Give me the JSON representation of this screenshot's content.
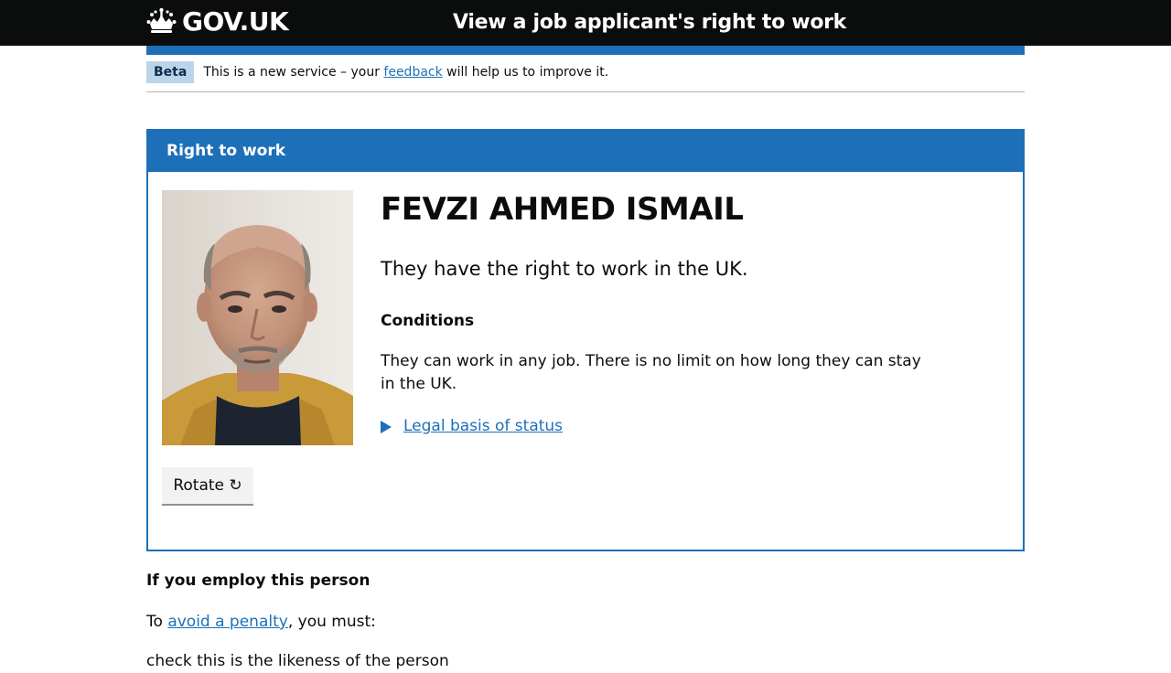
{
  "header": {
    "logo_text": "GOV.UK",
    "service_name": "View a job applicant's right to work"
  },
  "phase_banner": {
    "tag": "Beta",
    "text_before": "This is a new service – your ",
    "link_text": "feedback",
    "text_after": " will help us to improve it."
  },
  "panel": {
    "heading": "Right to work",
    "person_name": "FEVZI AHMED ISMAIL",
    "status": "They have the right to work in the UK.",
    "conditions_heading": "Conditions",
    "conditions_text": "They can work in any job. There is no limit on how long they can stay in the UK.",
    "details_summary": "Legal basis of status",
    "rotate_label": "Rotate ↻"
  },
  "employ": {
    "heading": "If you employ this person",
    "penalty_before": "To ",
    "penalty_link": "avoid a penalty",
    "penalty_after": ", you must:",
    "next_line": "check this is the likeness of the person"
  },
  "colors": {
    "header_bg": "#0b0c0c",
    "brand_blue": "#1d70b8",
    "beta_tag_bg": "#bbd4ea",
    "button_bg": "#f3f2f1"
  }
}
